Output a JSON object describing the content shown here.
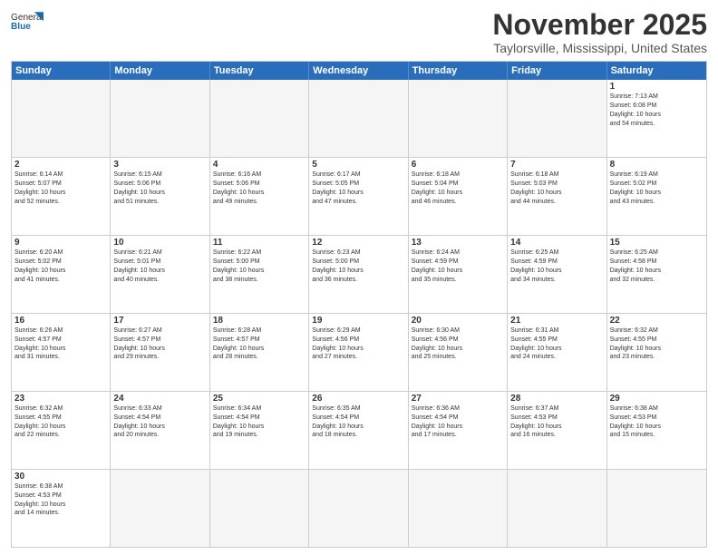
{
  "header": {
    "logo_general": "General",
    "logo_blue": "Blue",
    "month_title": "November 2025",
    "location": "Taylorsville, Mississippi, United States"
  },
  "weekdays": [
    "Sunday",
    "Monday",
    "Tuesday",
    "Wednesday",
    "Thursday",
    "Friday",
    "Saturday"
  ],
  "rows": [
    [
      {
        "day": "",
        "info": "",
        "empty": true
      },
      {
        "day": "",
        "info": "",
        "empty": true
      },
      {
        "day": "",
        "info": "",
        "empty": true
      },
      {
        "day": "",
        "info": "",
        "empty": true
      },
      {
        "day": "",
        "info": "",
        "empty": true
      },
      {
        "day": "",
        "info": "",
        "empty": true
      },
      {
        "day": "1",
        "info": "Sunrise: 7:13 AM\nSunset: 6:08 PM\nDaylight: 10 hours\nand 54 minutes."
      }
    ],
    [
      {
        "day": "2",
        "info": "Sunrise: 6:14 AM\nSunset: 5:07 PM\nDaylight: 10 hours\nand 52 minutes."
      },
      {
        "day": "3",
        "info": "Sunrise: 6:15 AM\nSunset: 5:06 PM\nDaylight: 10 hours\nand 51 minutes."
      },
      {
        "day": "4",
        "info": "Sunrise: 6:16 AM\nSunset: 5:06 PM\nDaylight: 10 hours\nand 49 minutes."
      },
      {
        "day": "5",
        "info": "Sunrise: 6:17 AM\nSunset: 5:05 PM\nDaylight: 10 hours\nand 47 minutes."
      },
      {
        "day": "6",
        "info": "Sunrise: 6:18 AM\nSunset: 5:04 PM\nDaylight: 10 hours\nand 46 minutes."
      },
      {
        "day": "7",
        "info": "Sunrise: 6:18 AM\nSunset: 5:03 PM\nDaylight: 10 hours\nand 44 minutes."
      },
      {
        "day": "8",
        "info": "Sunrise: 6:19 AM\nSunset: 5:02 PM\nDaylight: 10 hours\nand 43 minutes."
      }
    ],
    [
      {
        "day": "9",
        "info": "Sunrise: 6:20 AM\nSunset: 5:02 PM\nDaylight: 10 hours\nand 41 minutes."
      },
      {
        "day": "10",
        "info": "Sunrise: 6:21 AM\nSunset: 5:01 PM\nDaylight: 10 hours\nand 40 minutes."
      },
      {
        "day": "11",
        "info": "Sunrise: 6:22 AM\nSunset: 5:00 PM\nDaylight: 10 hours\nand 38 minutes."
      },
      {
        "day": "12",
        "info": "Sunrise: 6:23 AM\nSunset: 5:00 PM\nDaylight: 10 hours\nand 36 minutes."
      },
      {
        "day": "13",
        "info": "Sunrise: 6:24 AM\nSunset: 4:59 PM\nDaylight: 10 hours\nand 35 minutes."
      },
      {
        "day": "14",
        "info": "Sunrise: 6:25 AM\nSunset: 4:59 PM\nDaylight: 10 hours\nand 34 minutes."
      },
      {
        "day": "15",
        "info": "Sunrise: 6:25 AM\nSunset: 4:58 PM\nDaylight: 10 hours\nand 32 minutes."
      }
    ],
    [
      {
        "day": "16",
        "info": "Sunrise: 6:26 AM\nSunset: 4:57 PM\nDaylight: 10 hours\nand 31 minutes."
      },
      {
        "day": "17",
        "info": "Sunrise: 6:27 AM\nSunset: 4:57 PM\nDaylight: 10 hours\nand 29 minutes."
      },
      {
        "day": "18",
        "info": "Sunrise: 6:28 AM\nSunset: 4:57 PM\nDaylight: 10 hours\nand 28 minutes."
      },
      {
        "day": "19",
        "info": "Sunrise: 6:29 AM\nSunset: 4:56 PM\nDaylight: 10 hours\nand 27 minutes."
      },
      {
        "day": "20",
        "info": "Sunrise: 6:30 AM\nSunset: 4:56 PM\nDaylight: 10 hours\nand 25 minutes."
      },
      {
        "day": "21",
        "info": "Sunrise: 6:31 AM\nSunset: 4:55 PM\nDaylight: 10 hours\nand 24 minutes."
      },
      {
        "day": "22",
        "info": "Sunrise: 6:32 AM\nSunset: 4:55 PM\nDaylight: 10 hours\nand 23 minutes."
      }
    ],
    [
      {
        "day": "23",
        "info": "Sunrise: 6:32 AM\nSunset: 4:55 PM\nDaylight: 10 hours\nand 22 minutes."
      },
      {
        "day": "24",
        "info": "Sunrise: 6:33 AM\nSunset: 4:54 PM\nDaylight: 10 hours\nand 20 minutes."
      },
      {
        "day": "25",
        "info": "Sunrise: 6:34 AM\nSunset: 4:54 PM\nDaylight: 10 hours\nand 19 minutes."
      },
      {
        "day": "26",
        "info": "Sunrise: 6:35 AM\nSunset: 4:54 PM\nDaylight: 10 hours\nand 18 minutes."
      },
      {
        "day": "27",
        "info": "Sunrise: 6:36 AM\nSunset: 4:54 PM\nDaylight: 10 hours\nand 17 minutes."
      },
      {
        "day": "28",
        "info": "Sunrise: 6:37 AM\nSunset: 4:53 PM\nDaylight: 10 hours\nand 16 minutes."
      },
      {
        "day": "29",
        "info": "Sunrise: 6:38 AM\nSunset: 4:53 PM\nDaylight: 10 hours\nand 15 minutes."
      }
    ],
    [
      {
        "day": "30",
        "info": "Sunrise: 6:38 AM\nSunset: 4:53 PM\nDaylight: 10 hours\nand 14 minutes."
      },
      {
        "day": "",
        "info": "",
        "empty": true
      },
      {
        "day": "",
        "info": "",
        "empty": true
      },
      {
        "day": "",
        "info": "",
        "empty": true
      },
      {
        "day": "",
        "info": "",
        "empty": true
      },
      {
        "day": "",
        "info": "",
        "empty": true
      },
      {
        "day": "",
        "info": "",
        "empty": true
      }
    ]
  ]
}
